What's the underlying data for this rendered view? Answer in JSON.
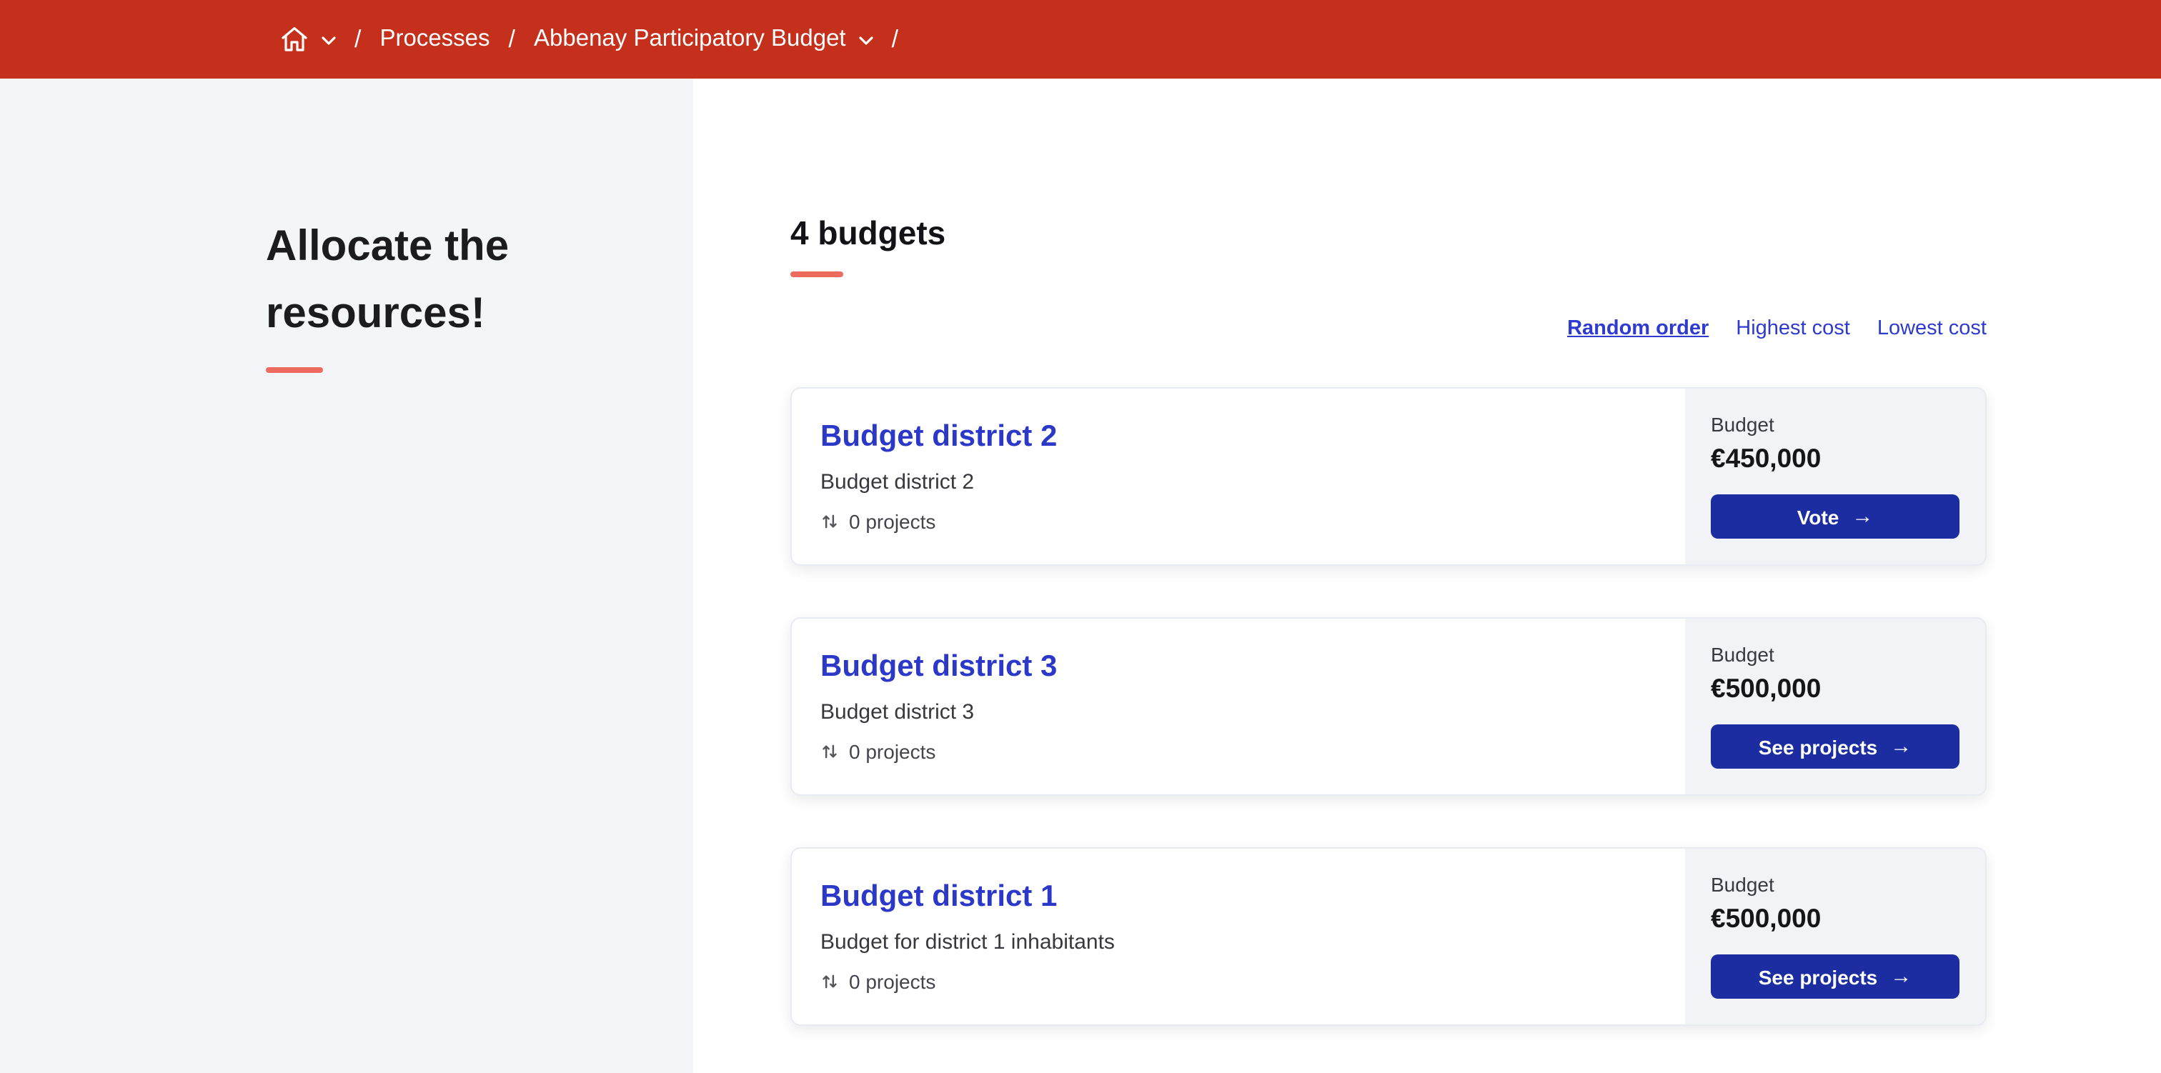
{
  "header": {
    "breadcrumb": {
      "separator": "/",
      "items": [
        {
          "label": "Processes"
        },
        {
          "label": "Abbenay Participatory Budget"
        }
      ]
    }
  },
  "sidebar": {
    "title": "Allocate the resources!"
  },
  "main": {
    "count_heading": "4 budgets",
    "sort": {
      "options": [
        {
          "label": "Random order",
          "active": true
        },
        {
          "label": "Highest cost",
          "active": false
        },
        {
          "label": "Lowest cost",
          "active": false
        }
      ]
    },
    "budget_label": "Budget",
    "cards": [
      {
        "title": "Budget district 2",
        "description": "Budget district 2",
        "projects": "0 projects",
        "amount": "€450,000",
        "cta": "Vote"
      },
      {
        "title": "Budget district 3",
        "description": "Budget district 3",
        "projects": "0 projects",
        "amount": "€500,000",
        "cta": "See projects"
      },
      {
        "title": "Budget district 1",
        "description": "Budget for district 1 inhabitants",
        "projects": "0 projects",
        "amount": "€500,000",
        "cta": "See projects"
      }
    ]
  },
  "icons": {
    "arrow_right": "→"
  },
  "colors": {
    "header_red": "#c5301d",
    "accent_salmon": "#ec6a5e",
    "link_blue": "#2e3bce",
    "title_blue": "#2b38c8",
    "button_blue": "#1c2ca1",
    "sidebar_bg": "#f4f5f9",
    "aside_bg": "#f2f3f7"
  }
}
